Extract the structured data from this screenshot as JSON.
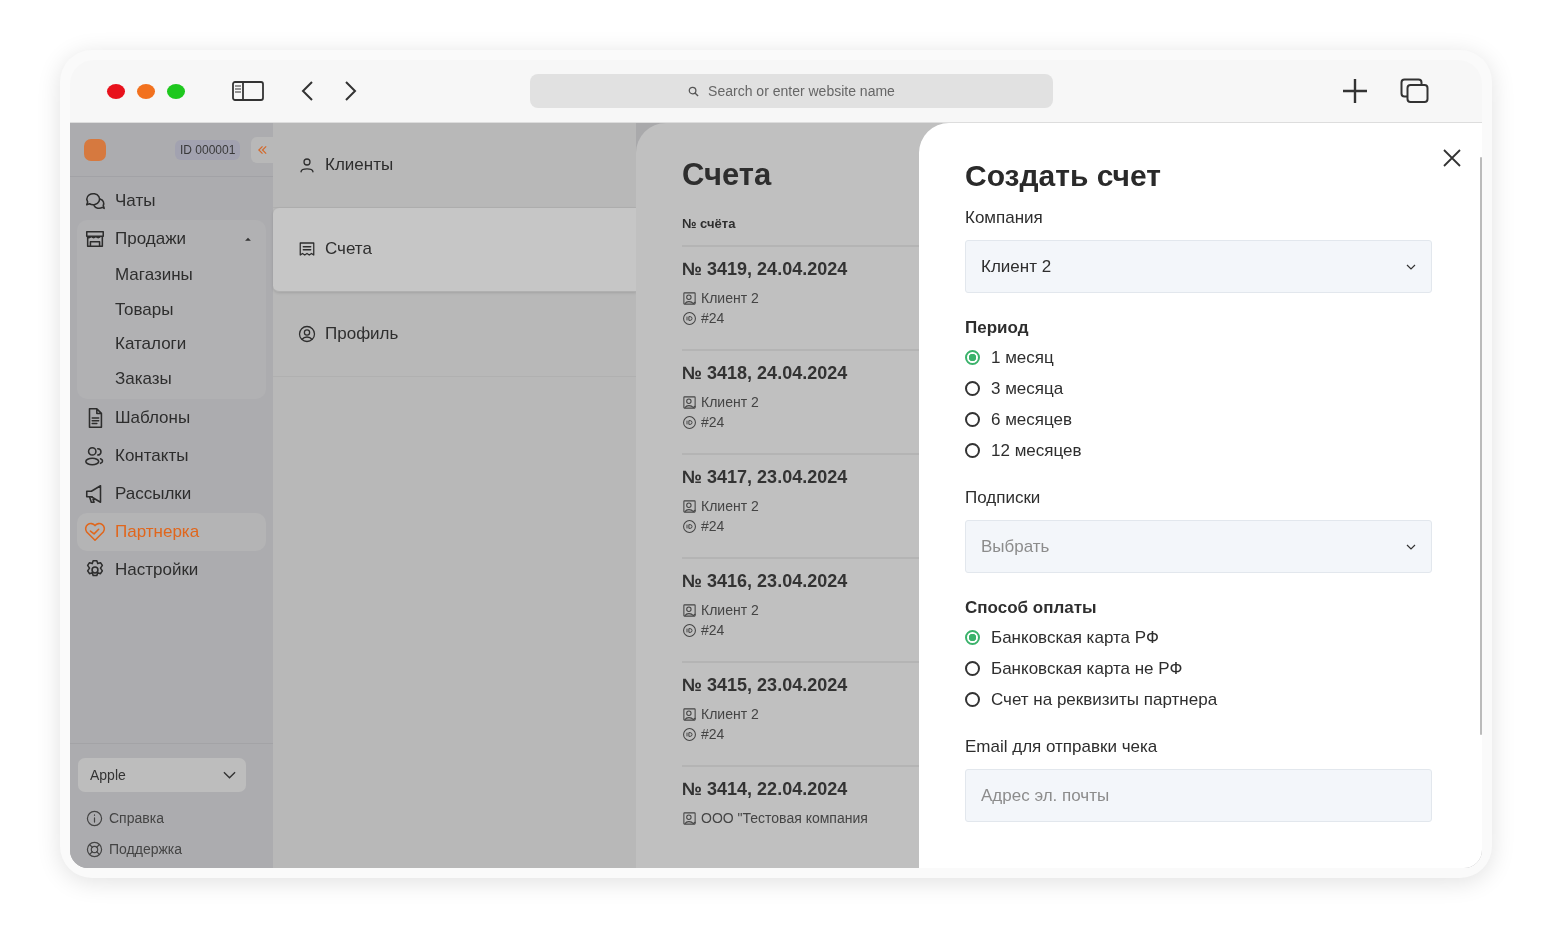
{
  "browser": {
    "search_placeholder": "Search or enter website name"
  },
  "sidebar": {
    "account_id": "ID 000001",
    "items": [
      {
        "label": "Чаты",
        "selected": false
      },
      {
        "label": "Продажи",
        "selected": false,
        "expanded": true,
        "children": [
          {
            "label": "Магазины"
          },
          {
            "label": "Товары"
          },
          {
            "label": "Каталоги"
          },
          {
            "label": "Заказы"
          }
        ]
      },
      {
        "label": "Шаблоны",
        "selected": false
      },
      {
        "label": "Контакты",
        "selected": false
      },
      {
        "label": "Рассылки",
        "selected": false
      },
      {
        "label": "Партнерка",
        "selected": true
      },
      {
        "label": "Настройки",
        "selected": false
      }
    ],
    "workspace": "Apple",
    "footer_links": [
      "Справка",
      "Поддержка"
    ]
  },
  "nav": {
    "items": [
      {
        "label": "Клиенты",
        "selected": false
      },
      {
        "label": "Счета",
        "selected": true
      },
      {
        "label": "Профиль",
        "selected": false
      }
    ]
  },
  "invoices": {
    "title": "Счета",
    "column": "№ счёта",
    "rows": [
      {
        "number": "№ 3419, 24.04.2024",
        "client": "Клиент 2",
        "ref": "#24"
      },
      {
        "number": "№ 3418, 24.04.2024",
        "client": "Клиент 2",
        "ref": "#24"
      },
      {
        "number": "№ 3417, 23.04.2024",
        "client": "Клиент 2",
        "ref": "#24"
      },
      {
        "number": "№ 3416, 23.04.2024",
        "client": "Клиент 2",
        "ref": "#24"
      },
      {
        "number": "№ 3415, 23.04.2024",
        "client": "Клиент 2",
        "ref": "#24"
      },
      {
        "number": "№ 3414, 22.04.2024",
        "client": "ООО \"Тестовая компания"
      }
    ]
  },
  "modal": {
    "title": "Создать счет",
    "fields": [
      {
        "kind": "select",
        "label": "Компания",
        "value": "Клиент 2"
      },
      {
        "kind": "radio",
        "label": "Период",
        "options": [
          {
            "label": "1 месяц",
            "selected": true
          },
          {
            "label": "3 месяца",
            "selected": false
          },
          {
            "label": "6 месяцев",
            "selected": false
          },
          {
            "label": "12 месяцев",
            "selected": false
          }
        ]
      },
      {
        "kind": "select",
        "label": "Подписки",
        "placeholder": "Выбрать"
      },
      {
        "kind": "radio",
        "label": "Способ оплаты",
        "options": [
          {
            "label": "Банковская карта РФ",
            "selected": true
          },
          {
            "label": "Банковская карта не РФ",
            "selected": false
          },
          {
            "label": "Счет на реквизиты партнера",
            "selected": false
          }
        ]
      },
      {
        "kind": "input",
        "label": "Email для отправки чека",
        "placeholder": "Адрес эл. почты"
      }
    ]
  }
}
